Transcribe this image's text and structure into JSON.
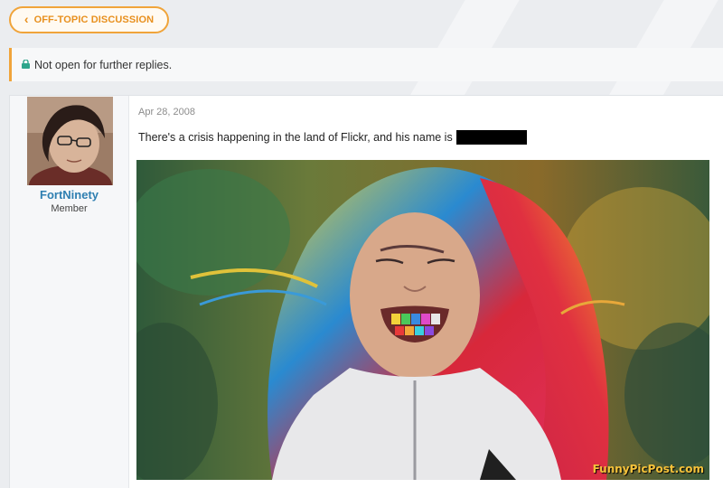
{
  "nav": {
    "back_label": "OFF-TOPIC DISCUSSION"
  },
  "notice": {
    "text": "Not open for further replies."
  },
  "post": {
    "author": "FortNinety",
    "author_title": "Member",
    "date": "Apr 28, 2008",
    "text": "There's a crisis happening in the land of Flickr, and his name is"
  },
  "colors": {
    "accent": "#f0a43a",
    "username": "#2f7fb1"
  },
  "watermark": "FunnyPicPost.com"
}
